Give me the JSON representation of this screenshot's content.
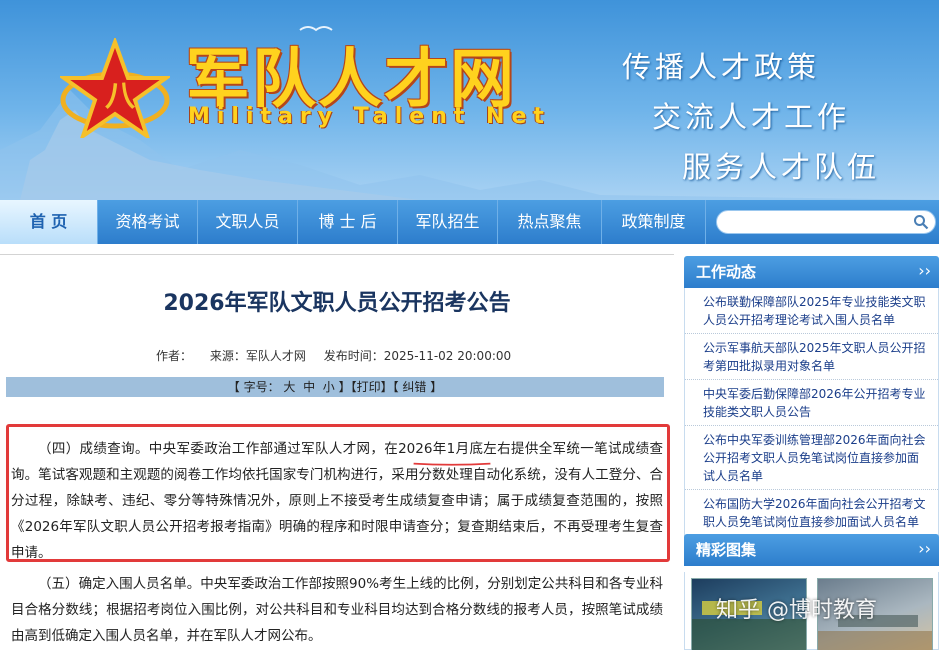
{
  "header": {
    "site_title_cn": "军队人才网",
    "site_title_en": "Military Talent Net",
    "slogans": [
      "传播人才政策",
      "交流人才工作",
      "服务人才队伍"
    ]
  },
  "nav": {
    "items": [
      "首 页",
      "资格考试",
      "文职人员",
      "博 士 后",
      "军队招生",
      "热点聚焦",
      "政策制度"
    ],
    "search_placeholder": ""
  },
  "article": {
    "title": "2026年军队文职人员公开招考公告",
    "author_label": "作者：",
    "source": "来源：军队人才网",
    "publish_time": "发布时间：2025-11-02 20:00:00",
    "toolbar": {
      "font_size_label": "【 字号：",
      "size_large": "大",
      "size_medium": "中",
      "size_small": "小",
      "close_bracket": " 】",
      "print": "【打印】",
      "error": "【 纠错 】"
    },
    "para4": "（四）成绩查询。中央军委政治工作部通过军队人才网，在2026年1月底左右提供全军统一笔试成绩查询。笔试客观题和主观题的阅卷工作均依托国家专门机构进行，采用分数处理自动化系统，没有人工登分、合分过程，除缺考、违纪、零分等特殊情况外，原则上不接受考生成绩复查申请；属于成绩复查范围的，按照《2026年军队文职人员公开招考报考指南》明确的程序和时限申请查分；复查期结束后，不再受理考生复查申请。",
    "para5": "（五）确定入围人员名单。中央军委政治工作部按照90%考生上线的比例，分别划定公共科目和各专业科目合格分数线；根据招考岗位入围比例，对公共科目和专业科目均达到合格分数线的报考人员，按照笔试成绩由高到低确定入围人员名单，并在军队人才网公布。"
  },
  "sidebar": {
    "work_title": "工作动态",
    "more": "››",
    "news": [
      "公布联勤保障部队2025年专业技能类文职人员公开招考理论考试入围人员名单",
      "公示军事航天部队2025年文职人员公开招考第四批拟录用对象名单",
      "中央军委后勤保障部2026年公开招考专业技能类文职人员公告",
      "公布中央军委训练管理部2026年面向社会公开招考文职人员免笔试岗位直接参加面试人员名单",
      "公布国防大学2026年面向社会公开招考文职人员免笔试岗位直接参加面试人员名单"
    ],
    "gallery_title": "精彩图集"
  },
  "watermark": "知乎 @博时教育",
  "colors": {
    "nav_blue": "#2d7dcc",
    "title_navy": "#1a3560",
    "highlight_red": "#e23a3a",
    "link_blue": "#1b3e8a"
  }
}
